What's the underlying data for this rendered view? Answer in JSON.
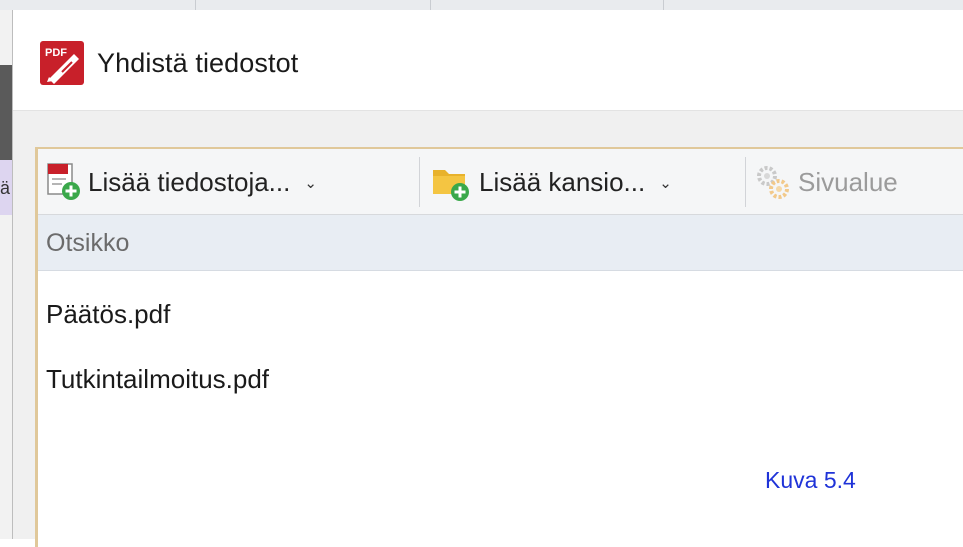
{
  "dialog": {
    "title": "Yhdistä tiedostot",
    "app_icon_text": "PDF"
  },
  "toolbar": {
    "add_files_label": "Lisää tiedostoja...",
    "add_folder_label": "Lisää kansio...",
    "page_range_label": "Sivualue"
  },
  "file_list": {
    "column_header": "Otsikko",
    "files": [
      "Päätös.pdf",
      "Tutkintailmoitus.pdf"
    ]
  },
  "caption": "Kuva 5.4",
  "colors": {
    "caption": "#1f33d8",
    "pdf_icon_red": "#c8202a",
    "folder_yellow": "#f4c542",
    "add_badge_green": "#3aa84a"
  },
  "icons": {
    "app": "pdf-pen-icon",
    "add_files": "pdf-add-icon",
    "add_folder": "folder-add-icon",
    "page_range": "gears-icon"
  }
}
